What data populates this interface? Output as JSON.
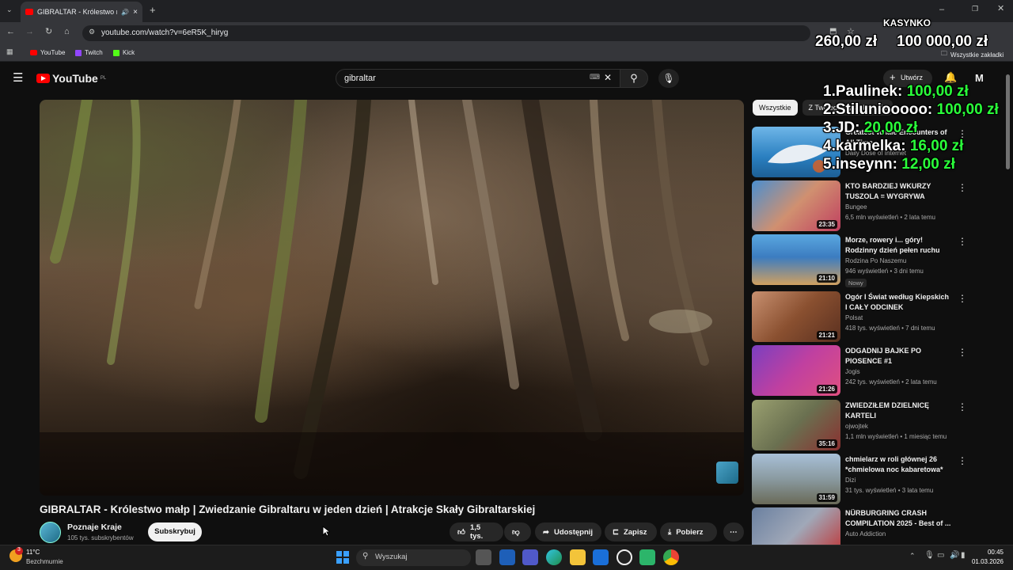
{
  "browser": {
    "tab_title": "GIBRALTAR - Królestwo małp",
    "url": "youtube.com/watch?v=6eR5K_hiryg",
    "bookmarks": [
      "YouTube",
      "Twitch",
      "Kick"
    ],
    "all_bookmarks": "Wszystkie zakładki"
  },
  "youtube": {
    "logo": "YouTube",
    "region": "PL",
    "search_value": "gibraltar",
    "create_label": "Utwórz",
    "avatar_letter": "M"
  },
  "video": {
    "title": "GIBRALTAR - Królestwo małp | Zwiedzanie Gibraltaru w jeden dzień | Atrakcje Skały Gibraltarskiej",
    "channel": "Poznaje Kraje",
    "subscribers": "105 tys. subskrybentów",
    "subscribe_label": "Subskrybuj",
    "likes": "1,5 tys.",
    "share_label": "Udostępnij",
    "save_label": "Zapisz",
    "download_label": "Pobierz"
  },
  "chips": [
    "Wszystkie",
    "Z Twojego wyszukiwania"
  ],
  "recommendations": [
    {
      "title": "Greatest Whale Encounters of All Time",
      "channel": "Daily Dose of Internet",
      "meta": "",
      "duration": "",
      "new": ""
    },
    {
      "title": "KTO BARDZIEJ WKURZY TUSZOLA = WYGRYWA",
      "channel": "Bungee",
      "meta": "6,5 mln wyświetleń • 2 lata temu",
      "duration": "23:35",
      "new": ""
    },
    {
      "title": "Morze, rowery i... góry! Rodzinny dzień pełen ruchu na...",
      "channel": "Rodzina Po Naszemu",
      "meta": "946 wyświetleń • 3 dni temu",
      "duration": "21:10",
      "new": "Nowy"
    },
    {
      "title": "Ogór I Świat według Kiepskich I CAŁY ODCINEK",
      "channel": "Polsat",
      "meta": "418 tys. wyświetleń • 7 dni temu",
      "duration": "21:21",
      "new": ""
    },
    {
      "title": "ODGADNIJ BAJKE PO PIOSENCE #1",
      "channel": "Jogis",
      "meta": "242 tys. wyświetleń • 2 lata temu",
      "duration": "21:26",
      "new": ""
    },
    {
      "title": "ZWIEDZIŁEM DZIELNICĘ KARTELI",
      "channel": "ojwojtek",
      "meta": "1,1 mln wyświetleń • 1 miesiąc temu",
      "duration": "35:16",
      "new": ""
    },
    {
      "title": "chmielarz w roli głównej 26 *chmielowa noc kabaretowa*",
      "channel": "Dizi",
      "meta": "31 tys. wyświetleń • 3 lata temu",
      "duration": "31:59",
      "new": ""
    },
    {
      "title": "NÜRBURGRING CRASH COMPILATION 2025 - Best of ...",
      "channel": "Auto Addiction",
      "meta": "",
      "duration": "",
      "new": ""
    }
  ],
  "overlay": {
    "casino_label": "KASYNKO",
    "balance_1": "260,00 zł",
    "balance_2": "100 000,00 zł",
    "leaderboard": [
      {
        "rank_name": "1.Paulinek:",
        "amount": "100,00 zł"
      },
      {
        "rank_name": "2.Stiluniooooo:",
        "amount": "100,00 zł"
      },
      {
        "rank_name": "3.JD:",
        "amount": "20,00 zł"
      },
      {
        "rank_name": "4.karmelka:",
        "amount": "16,00 zł"
      },
      {
        "rank_name": "5.inseynn:",
        "amount": "12,00 zł"
      }
    ]
  },
  "taskbar": {
    "temperature": "11°C",
    "weather": "Bezchmurnie",
    "search_placeholder": "Wyszukaj",
    "time": "00:45",
    "date": "01.03.2026",
    "weather_badge": "3"
  }
}
